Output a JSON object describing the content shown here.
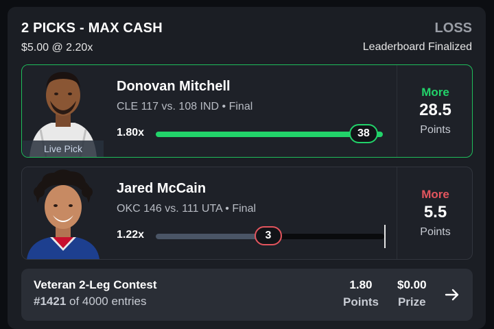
{
  "header": {
    "title": "2 PICKS - MAX CASH",
    "entry": "$5.00 @ 2.20x",
    "result": "LOSS",
    "status": "Leaderboard Finalized"
  },
  "picks": [
    {
      "player": "Donovan Mitchell",
      "game": "CLE 117 vs. 108 IND • Final",
      "multiplier": "1.80x",
      "actual": "38",
      "direction": "More",
      "line": "28.5",
      "stat": "Points",
      "badge": "Live Pick",
      "progress": 1.0,
      "hit": true,
      "color": "#22d36a"
    },
    {
      "player": "Jared McCain",
      "game": "OKC 146 vs. 111 UTA • Final",
      "multiplier": "1.22x",
      "actual": "3",
      "direction": "More",
      "line": "5.5",
      "stat": "Points",
      "progress": 0.545,
      "hit": false,
      "color": "#e4555e"
    }
  ],
  "contest": {
    "name": "Veteran 2-Leg Contest",
    "rank": "#1421",
    "entries": "of 4000 entries",
    "points_value": "1.80",
    "points_label": "Points",
    "prize_value": "$0.00",
    "prize_label": "Prize",
    "arrow_icon": "arrow-right-icon"
  }
}
